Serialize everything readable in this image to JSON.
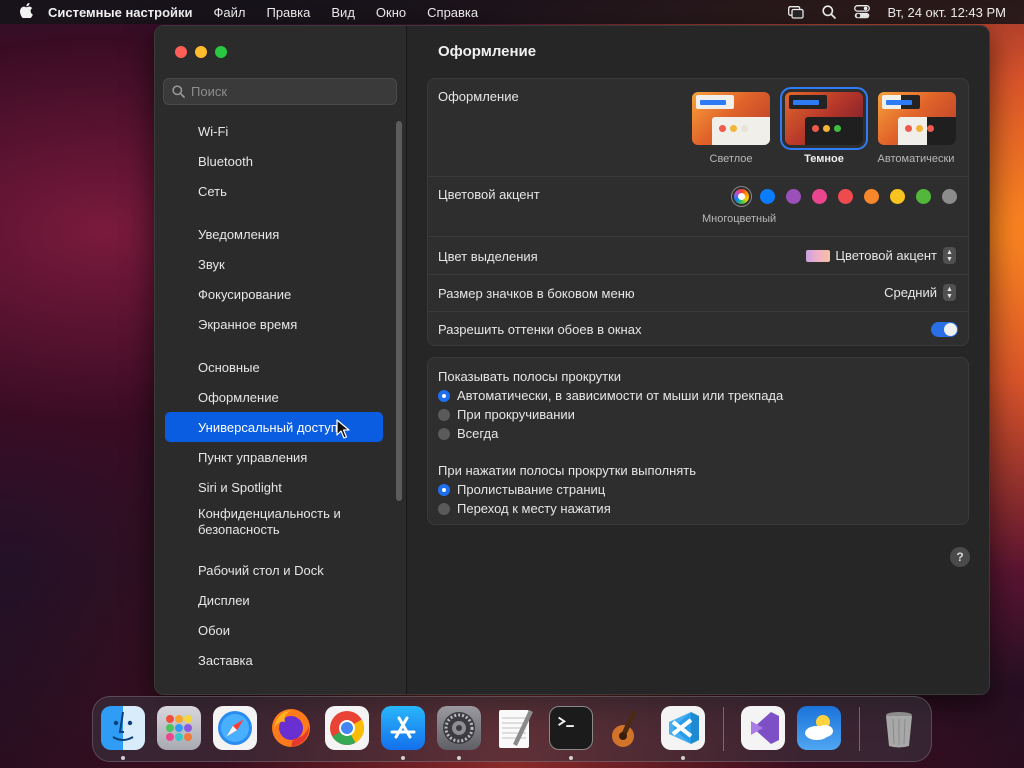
{
  "menubar": {
    "app_name": "Системные настройки",
    "menus": [
      "Файл",
      "Правка",
      "Вид",
      "Окно",
      "Справка"
    ],
    "clock": "Вт, 24 окт.  12:43 PM"
  },
  "sidebar": {
    "search_placeholder": "Поиск",
    "items": [
      {
        "label": "Wi-Fi"
      },
      {
        "label": "Bluetooth"
      },
      {
        "label": "Сеть"
      },
      {
        "label": "Уведомления"
      },
      {
        "label": "Звук"
      },
      {
        "label": "Фокусирование"
      },
      {
        "label": "Экранное время"
      },
      {
        "label": "Основные"
      },
      {
        "label": "Оформление"
      },
      {
        "label": "Универсальный доступ"
      },
      {
        "label": "Пункт управления"
      },
      {
        "label": "Siri и Spotlight"
      },
      {
        "label": "Конфиденциальность и безопасность"
      },
      {
        "label": "Рабочий стол и Dock"
      },
      {
        "label": "Дисплеи"
      },
      {
        "label": "Обои"
      },
      {
        "label": "Заставка"
      }
    ],
    "active_item": "Универсальный доступ"
  },
  "content": {
    "title": "Оформление",
    "appearance": {
      "label": "Оформление",
      "options": [
        {
          "label": "Светлое",
          "selected": false
        },
        {
          "label": "Темное",
          "selected": true
        },
        {
          "label": "Автоматически",
          "selected": false
        }
      ]
    },
    "accent": {
      "label": "Цветовой акцент",
      "selected_caption": "Многоцветный",
      "colors": [
        "multicolor",
        "#0a7cff",
        "#9b4fb8",
        "#e9468f",
        "#ef4b4f",
        "#f5862a",
        "#f7c31f",
        "#53b73b",
        "#8c8c8c"
      ]
    },
    "highlight": {
      "label": "Цвет выделения",
      "value": "Цветовой акцент"
    },
    "sidebar_icon_size": {
      "label": "Размер значков в боковом меню",
      "value": "Средний"
    },
    "wallpaper_tinting": {
      "label": "Разрешить оттенки обоев в окнах",
      "on": true
    },
    "scrollbars": {
      "title": "Показывать полосы прокрутки",
      "options": [
        {
          "label": "Автоматически, в зависимости от мыши или трекпада",
          "selected": true
        },
        {
          "label": "При прокручивании",
          "selected": false
        },
        {
          "label": "Всегда",
          "selected": false
        }
      ]
    },
    "click_scrollbar": {
      "title": "При нажатии полосы прокрутки выполнять",
      "options": [
        {
          "label": "Пролистывание страниц",
          "selected": true
        },
        {
          "label": "Переход к месту нажатия",
          "selected": false
        }
      ]
    },
    "help": "?"
  },
  "dock": {
    "apps": [
      "finder",
      "launchpad",
      "safari",
      "firefox",
      "chrome",
      "app-store",
      "system-settings",
      "textedit",
      "terminal",
      "garageband",
      "vscode",
      "visual-studio",
      "weather",
      "trash"
    ]
  }
}
